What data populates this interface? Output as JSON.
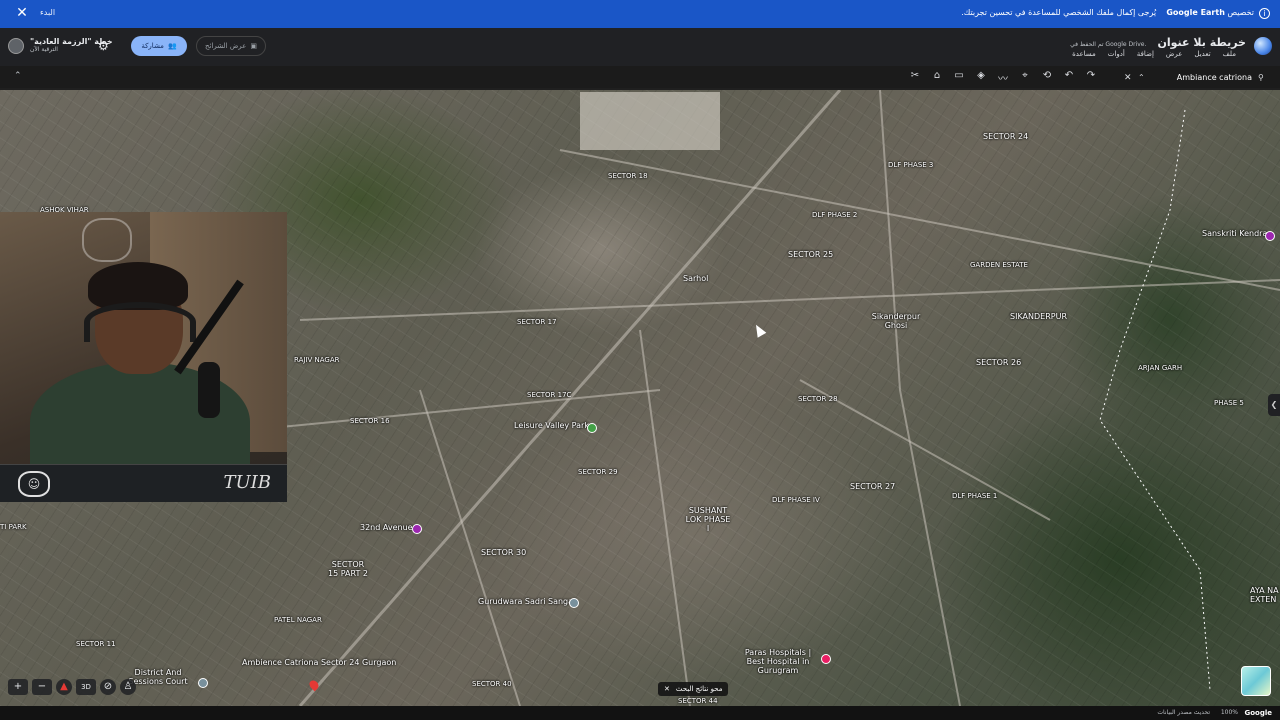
{
  "banner": {
    "close_icon": "close-icon",
    "start_label": "البدء",
    "message": "يُرجى إكمال ملفك الشخصي للمساعدة في تحسين تجربتك.",
    "brand": "Google Earth",
    "customize": "تخصيص",
    "info_icon": "info-icon"
  },
  "appbar": {
    "plan_title": "خطة \"الرزمة العادية\"",
    "plan_sub": "الترقية الآن",
    "share_label": "مشاركة",
    "slides_label": "عرض الشرائح",
    "map_title": "خريطة بلا عنوان",
    "saved_text": "تم الحفظ في Google Drive.",
    "menu": [
      "ملف",
      "تعديل",
      "عرض",
      "إضافة",
      "أدوات",
      "مساعدة"
    ]
  },
  "toolbar": {
    "search_query": "Ambiance catriona"
  },
  "map": {
    "labels": [
      {
        "text": "SECTOR 24",
        "big": true
      },
      {
        "text": "SECTOR 18"
      },
      {
        "text": "DLF PHASE 3"
      },
      {
        "text": "DLF PHASE 2"
      },
      {
        "text": "SECTOR 25",
        "big": true
      },
      {
        "text": "GARDEN ESTATE"
      },
      {
        "text": "Sarhol",
        "big": true
      },
      {
        "text": "SECTOR 17"
      },
      {
        "text": "Sikanderpur Ghosi",
        "big": true
      },
      {
        "text": "SIKANDERPUR",
        "big": true
      },
      {
        "text": "SECTOR 26",
        "big": true
      },
      {
        "text": "ARJAN GARH"
      },
      {
        "text": "RAJIV NAGAR"
      },
      {
        "text": "SECTOR 16"
      },
      {
        "text": "SECTOR 17C"
      },
      {
        "text": "SECTOR 28"
      },
      {
        "text": "PHASE 5"
      },
      {
        "text": "Leisure Valley Park",
        "big": true
      },
      {
        "text": "SECTOR 29"
      },
      {
        "text": "SECTOR 27",
        "big": true
      },
      {
        "text": "DLF PHASE 1"
      },
      {
        "text": "SUSHANT LOK PHASE I",
        "big": true
      },
      {
        "text": "DLF PHASE IV"
      },
      {
        "text": "32nd Avenue",
        "big": true
      },
      {
        "text": "SECTOR 30",
        "big": true
      },
      {
        "text": "SECTOR 15 PART 2",
        "big": true
      },
      {
        "text": "Gurudwara Sadri Sangat",
        "big": true
      },
      {
        "text": "PATEL NAGAR"
      },
      {
        "text": "SECTOR 11"
      },
      {
        "text": "District And Sessions Court",
        "big": true
      },
      {
        "text": "Ambience Catriona Sector 24 Gurgaon",
        "big": true
      },
      {
        "text": "SECTOR 40"
      },
      {
        "text": "Paras Hospitals | Best Hospital in Gurugram",
        "big": true
      },
      {
        "text": "SECTOR 44"
      },
      {
        "text": "AYA NA EXTEN",
        "big": true
      },
      {
        "text": "Sanskriti Kendra",
        "big": true
      },
      {
        "text": "ASHOK VIHAR"
      },
      {
        "text": "TI PARK"
      }
    ],
    "clear_results": "محو نتائج البحث",
    "threeD": "3D"
  },
  "overlay": {
    "brand_text": "TUIB"
  },
  "status": {
    "data_update": "تحديث مصدر البيانات",
    "zoom": "100%",
    "google": "Google"
  }
}
